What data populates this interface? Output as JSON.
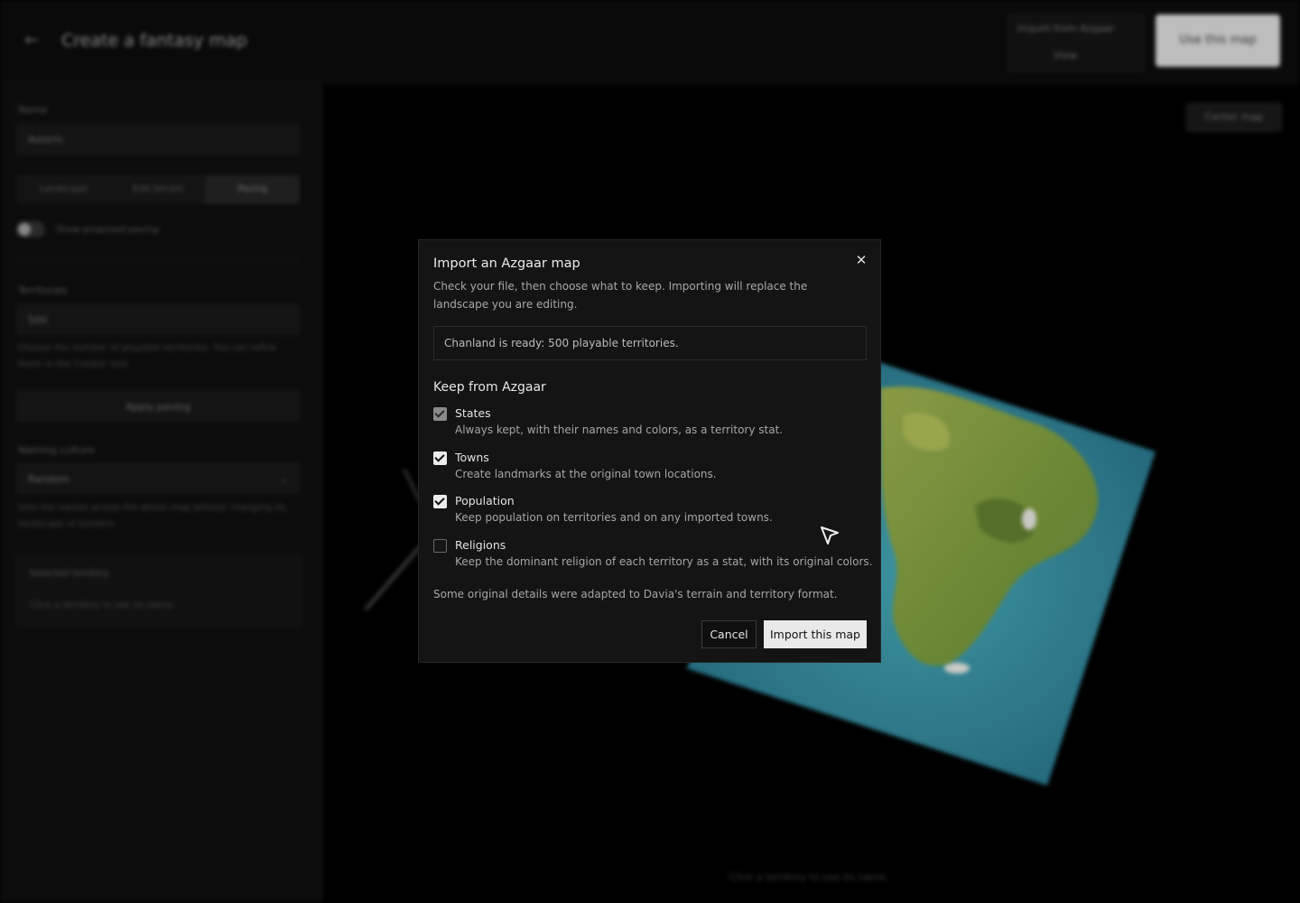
{
  "topbar": {
    "back_icon": "arrow-left-icon",
    "title": "Create a fantasy map",
    "import_label": "Import from Azgaar",
    "view_label": "View",
    "use_label": "Use this map"
  },
  "sidebar": {
    "name_label": "Name",
    "name_value": "Asterin",
    "modes": [
      "Landscape",
      "Edit terrain",
      "Paving"
    ],
    "active_mode": "Paving",
    "toggle_label": "Show proposed paving",
    "territories_label": "Territories",
    "territories_value": "500",
    "territories_help": "Choose the number of playable territories. You can refine them in the Creator tool.",
    "apply_label": "Apply paving",
    "naming_label": "Naming culture",
    "naming_value": "Random",
    "naming_help": "Sets the names across the whole map without changing its landscape or borders.",
    "selected_title": "Selected territory",
    "selected_hint": "Click a territory to see its name."
  },
  "canvas": {
    "center_label": "Center map",
    "hint": "Click a territory to see its name."
  },
  "modal": {
    "title": "Import an Azgaar map",
    "description": "Check your file, then choose what to keep. Importing will replace the landscape you are editing.",
    "status": "Chanland is ready: 500 playable territories.",
    "section_title": "Keep from Azgaar",
    "options": [
      {
        "name": "States",
        "description": "Always kept, with their names and colors, as a territory stat.",
        "state": "checked-disabled"
      },
      {
        "name": "Towns",
        "description": "Create landmarks at the original town locations.",
        "state": "checked"
      },
      {
        "name": "Population",
        "description": "Keep population on territories and on any imported towns.",
        "state": "checked"
      },
      {
        "name": "Religions",
        "description": "Keep the dominant religion of each territory as a stat, with its original colors.",
        "state": "unchecked"
      }
    ],
    "note": "Some original details were adapted to Davia's terrain and territory format.",
    "cancel_label": "Cancel",
    "import_label": "Import this map",
    "close_icon": "close-icon"
  },
  "colors": {
    "modal_bg": "#141414",
    "primary_button": "#e9e9e9",
    "ocean": "#2f7f8c",
    "land": "#7c8f3c"
  }
}
